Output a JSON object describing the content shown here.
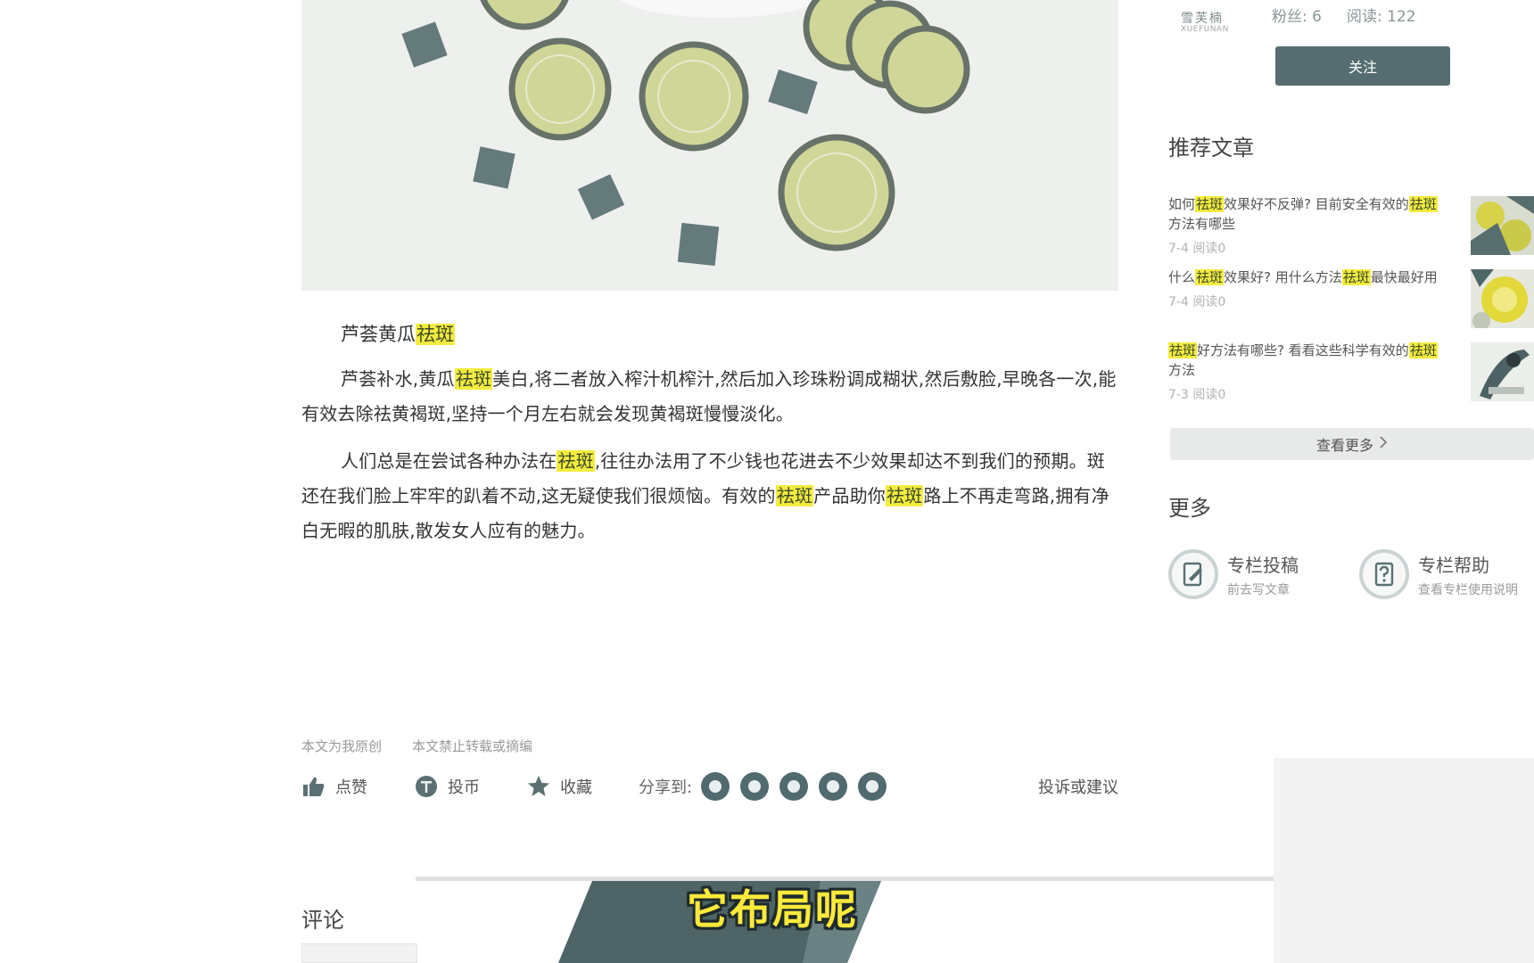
{
  "article": {
    "heading": {
      "prefix": "芦荟黄瓜",
      "highlight": "祛斑"
    },
    "paragraph1": {
      "p1": "芦荟补水,黄瓜",
      "h1": "祛斑",
      "p2": "美白,将二者放入榨汁机榨汁,然后加入珍珠粉调成糊状,然后敷脸,早晚各一次,能有效去除祛黄褐斑,坚持一个月左右就会发现黄褐斑慢慢淡化。"
    },
    "paragraph2": {
      "p1": "人们总是在尝试各种办法在",
      "h1": "祛斑",
      "p2": ",往往办法用了不少钱也花进去不少效果却达不到我们的预期。斑还在我们脸上牢牢的趴着不动,这无疑使我们很烦恼。有效的",
      "h2": "祛斑",
      "p3": "产品助你",
      "h3": "祛斑",
      "p4": "路上不再走弯路,拥有净白无暇的肌肤,散发女人应有的魅力。"
    }
  },
  "footer": {
    "original_note": "本文为我原创",
    "no_repost_note": "本文禁止转载或摘编",
    "like_label": "点赞",
    "coin_label": "投币",
    "favorite_label": "收藏",
    "share_label": "分享到:",
    "share_icons": [
      "dynamic-icon",
      "weibo-icon",
      "wechat-icon",
      "qzone-icon",
      "qq-icon"
    ],
    "report_label": "投诉或建议"
  },
  "comments": {
    "title": "评论"
  },
  "caption": {
    "text": "它布局呢"
  },
  "sidebar": {
    "author": {
      "logo_text": "雪芙楠",
      "logo_sub": "XUEFUNAN",
      "fans": "粉丝: 6",
      "reads": "阅读: 122",
      "follow_label": "关注"
    },
    "recommended": {
      "title": "推荐文章",
      "items": [
        {
          "segments": [
            "如何",
            "祛斑",
            "效果好不反弹?  目前安全有效的",
            "祛斑",
            "方法有哪些"
          ],
          "meta": "7-4 阅读0"
        },
        {
          "segments": [
            "什么",
            "祛斑",
            "效果好?  用什么方法",
            "祛斑",
            "最快最好用"
          ],
          "meta": "7-4 阅读0"
        },
        {
          "segments": [
            "",
            "祛斑",
            "好方法有哪些? 看看这些科学有效的",
            "祛斑",
            "方法"
          ],
          "meta": "7-3 阅读0"
        }
      ],
      "more_label": "查看更多"
    },
    "more": {
      "title": "更多",
      "submit": {
        "name": "专栏投稿",
        "desc": "前去写文章"
      },
      "help": {
        "name": "专栏帮助",
        "desc": "查看专栏使用说明"
      }
    }
  },
  "colors": {
    "accent": "#556d70",
    "highlight": "#f3ec3f",
    "caption_yellow": "#ffe93a"
  }
}
